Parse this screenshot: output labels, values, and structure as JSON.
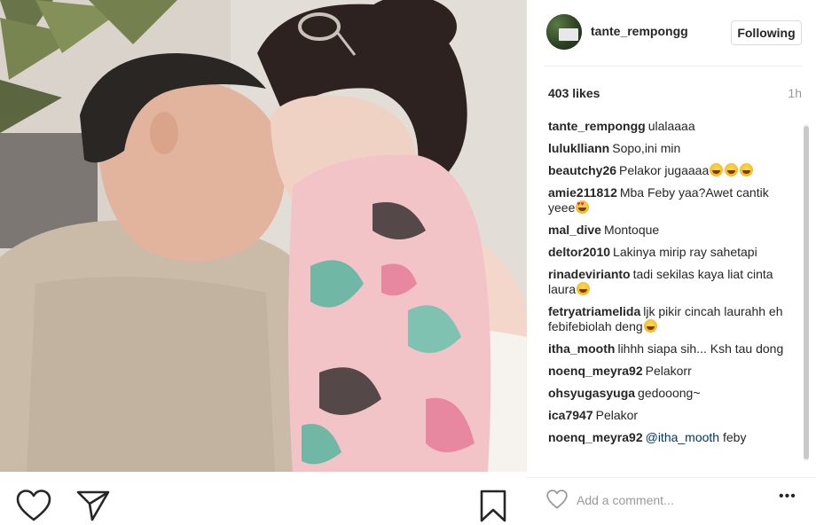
{
  "post": {
    "username": "tante_rempongg",
    "follow_label": "Following",
    "likes": "403 likes",
    "time": "1h"
  },
  "comments": [
    {
      "user": "tante_rempongg",
      "text": "ulalaaaa",
      "emoji": ""
    },
    {
      "user": "luluklliann",
      "text": "Sopo,ini min",
      "emoji": ""
    },
    {
      "user": "beautchy26",
      "text": "Pelakor jugaaaa",
      "emoji": "grin-x3"
    },
    {
      "user": "amie211812",
      "text": "Mba Feby yaa?Awet cantik yeee",
      "emoji": "heart-eyes"
    },
    {
      "user": "mal_dive",
      "text": "Montoque",
      "emoji": ""
    },
    {
      "user": "deltor2010",
      "text": "Lakinya mirip ray sahetapi",
      "emoji": ""
    },
    {
      "user": "rinadevirianto",
      "text": "tadi sekilas kaya liat cinta laura",
      "emoji": "grin"
    },
    {
      "user": "fetryatriamelida",
      "text": "ljk pikir cincah laurahh eh febifebiolah deng",
      "emoji": "grin"
    },
    {
      "user": "itha_mooth",
      "text": "lihhh siapa sih... Ksh tau dong",
      "emoji": ""
    },
    {
      "user": "noenq_meyra92",
      "text": "Pelakorr",
      "emoji": ""
    },
    {
      "user": "ohsyugasyuga",
      "text": "gedooong~",
      "emoji": ""
    },
    {
      "user": "ica7947",
      "text": "Pelakor",
      "emoji": ""
    },
    {
      "user": "noenq_meyra92",
      "mention": "@itha_mooth",
      "text": "feby",
      "emoji": ""
    }
  ],
  "comment_box": {
    "placeholder": "Add a comment...",
    "more_label": "•••"
  },
  "icons": {
    "like": "heart-icon",
    "comment": "comment-icon",
    "share": "share-icon",
    "save": "bookmark-icon",
    "options": "more-options-icon"
  }
}
